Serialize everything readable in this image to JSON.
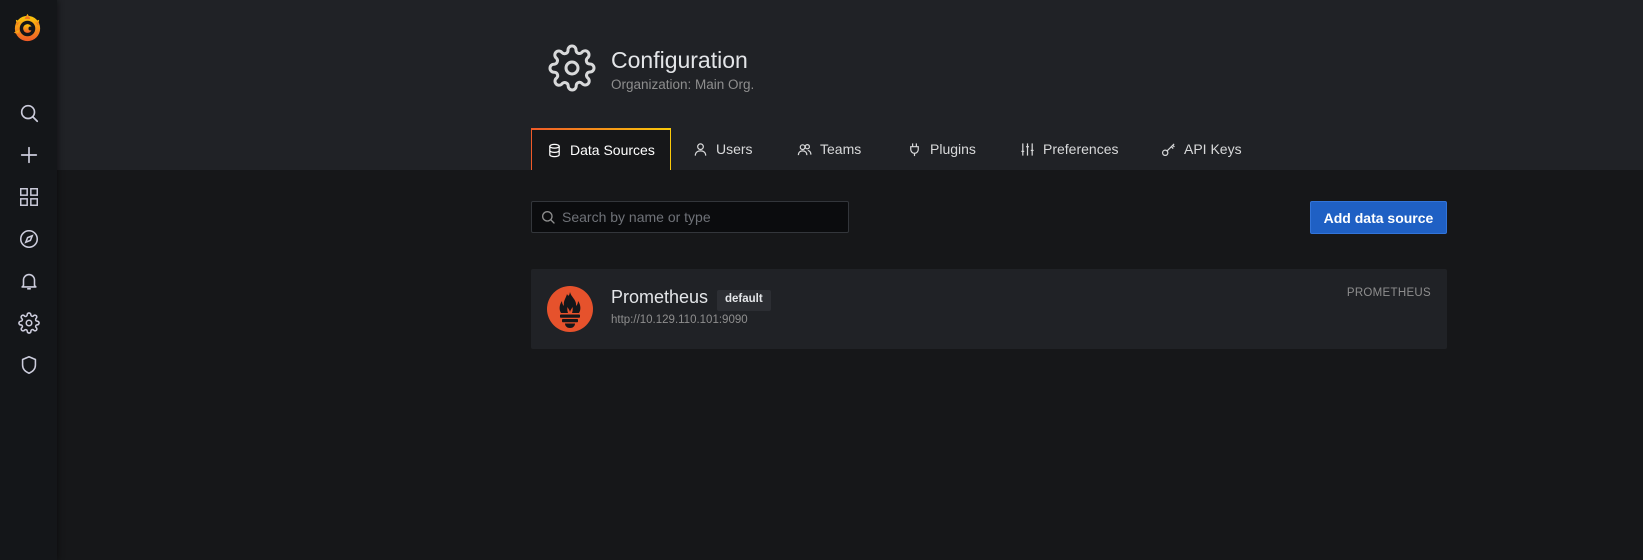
{
  "sidebar": {
    "logo": "grafana-logo",
    "items": [
      {
        "icon": "search-icon",
        "label": "Search"
      },
      {
        "icon": "plus-icon",
        "label": "Create"
      },
      {
        "icon": "dashboards-grid-icon",
        "label": "Dashboards"
      },
      {
        "icon": "compass-icon",
        "label": "Explore"
      },
      {
        "icon": "bell-icon",
        "label": "Alerting"
      },
      {
        "icon": "gear-icon",
        "label": "Configuration"
      },
      {
        "icon": "shield-icon",
        "label": "Server Admin"
      }
    ]
  },
  "header": {
    "title": "Configuration",
    "subtitle": "Organization: Main Org.",
    "icon": "gear-icon"
  },
  "tabs": [
    {
      "label": "Data Sources",
      "icon": "database-icon",
      "active": true
    },
    {
      "label": "Users",
      "icon": "user-icon",
      "active": false
    },
    {
      "label": "Teams",
      "icon": "users-icon",
      "active": false
    },
    {
      "label": "Plugins",
      "icon": "plug-icon",
      "active": false
    },
    {
      "label": "Preferences",
      "icon": "sliders-icon",
      "active": false
    },
    {
      "label": "API Keys",
      "icon": "key-icon",
      "active": false
    }
  ],
  "search": {
    "placeholder": "Search by name or type",
    "value": ""
  },
  "toolbar": {
    "add_label": "Add data source"
  },
  "datasources": [
    {
      "name": "Prometheus",
      "badge": "default",
      "url": "http://10.129.110.101:9090",
      "type": "PROMETHEUS",
      "logo": "prometheus-logo"
    }
  ],
  "colors": {
    "background": "#161719",
    "header": "#202226",
    "sidebar": "#141619",
    "primary_button": "#1f60c4",
    "tab_accent_start": "#f05a28",
    "tab_accent_end": "#fbca0a",
    "prometheus": "#e6522c"
  }
}
